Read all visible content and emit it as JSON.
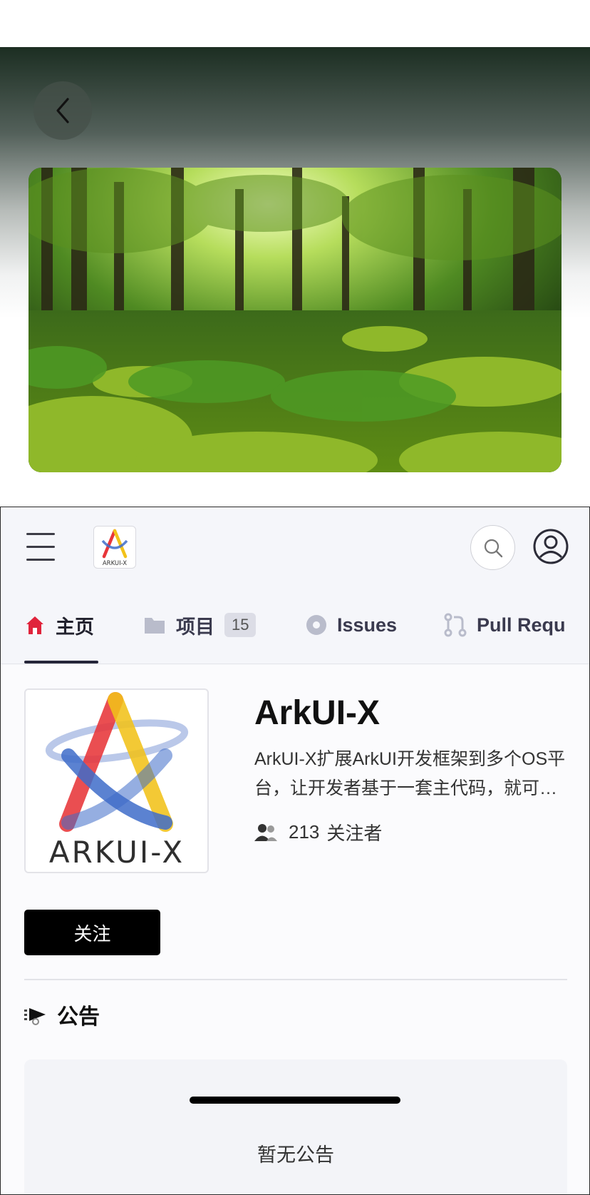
{
  "header": {
    "back_icon": "chevron-left-icon",
    "menu_icon": "hamburger-menu-icon",
    "search_icon": "search-icon",
    "user_icon": "user-circle-icon",
    "mini_logo_text": "ARKUI-X"
  },
  "tabs": [
    {
      "label": "主页",
      "icon": "home-icon",
      "active": true
    },
    {
      "label": "项目",
      "icon": "folder-icon",
      "badge": "15"
    },
    {
      "label": "Issues",
      "icon": "issue-dot-icon"
    },
    {
      "label": "Pull Requ",
      "icon": "pull-request-icon"
    }
  ],
  "repo": {
    "logo_text": "ARKUI-X",
    "title": "ArkUI-X",
    "description": "ArkUI-X扩展ArkUI开发框架到多个OS平台，让开发者基于一套主代码，就可以构建支持多平台的精美、高性能应用。",
    "followers_count": "213",
    "followers_label": "关注者",
    "follow_button": "关注"
  },
  "announcement": {
    "icon": "megaphone-icon",
    "title": "公告",
    "empty_text": "暂无公告"
  },
  "colors": {
    "accent_home": "#e0243c",
    "dark": "#000000",
    "panel_bg": "#f5f6fa"
  }
}
